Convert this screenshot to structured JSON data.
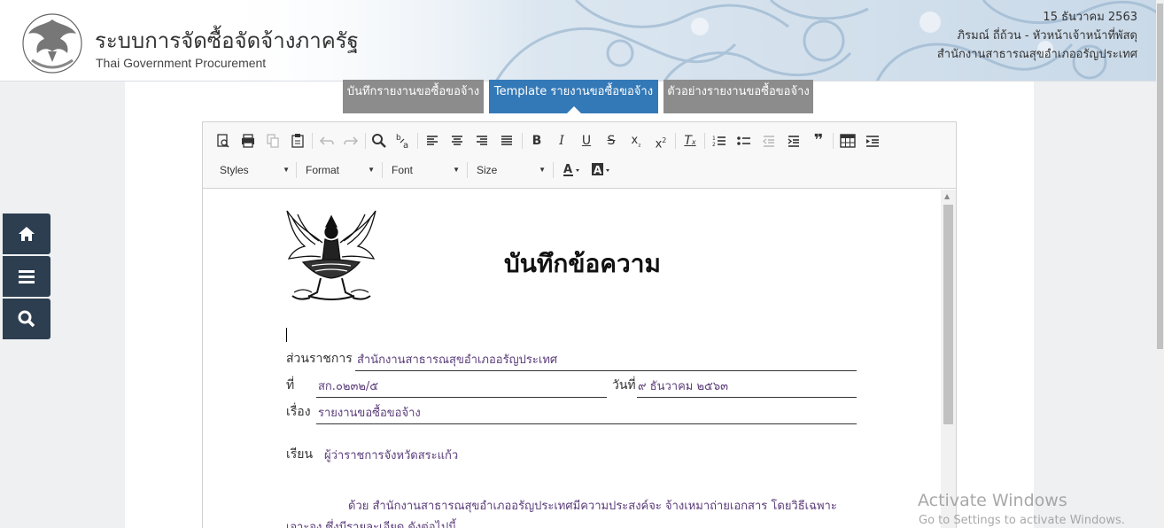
{
  "header": {
    "title": "ระบบการจัดซื้อจัดจ้างภาครัฐ",
    "subtitle": "Thai Government Procurement",
    "date": "15 ธันวาคม 2563",
    "user": "ภิรมณ์ ถี่ถ้วน - หัวหน้าเจ้าหน้าที่พัสดุ",
    "office": "สำนักงานสาธารณสุขอำเภออรัญประเทศ",
    "logo_icon": "thai-gov-procurement-logo"
  },
  "tabs": [
    {
      "label": "บันทึกรายงานขอซื้อขอจ้าง",
      "active": false
    },
    {
      "label": "Template รายงานขอซื้อขอจ้าง",
      "active": true
    },
    {
      "label": "ตัวอย่างรายงานขอซื้อขอจ้าง",
      "active": false
    }
  ],
  "toolbar": {
    "combos": {
      "styles": "Styles",
      "format": "Format",
      "font": "Font",
      "size": "Size"
    }
  },
  "document": {
    "emblem_icon": "garuda-emblem",
    "title": "บันทึกข้อความ",
    "agency_label": "ส่วนราชการ",
    "agency_value": "สำนักงานสาธารณสุขอำเภออรัญประเทศ",
    "ref_label": "ที่",
    "ref_value": "สก.๐๒๓๒/๕",
    "date_label": "วันที่",
    "date_value": "๙ ธันวาคม ๒๕๖๓",
    "subject_label": "เรื่อง",
    "subject_value": "รายงานขอซื้อขอจ้าง",
    "to_label": "เรียน",
    "to_value": "ผู้ว่าราชการจังหวัดสระแก้ว",
    "body_line1": "ด้วย สำนักงานสาธารณสุขอำเภออรัญประเทศมีความประสงค์จะ จ้างเหมาถ่ายเอกสาร โดยวิธีเฉพาะ",
    "body_line2": "เจาะจง ซึ่งมีรายละเอียด ดังต่อไปนี้"
  },
  "sidenav": [
    "home-icon",
    "menu-icon",
    "search-icon"
  ],
  "watermark": {
    "title": "Activate Windows",
    "sub": "Go to Settings to activate Windows."
  },
  "colors": {
    "tab_active": "#3479b7",
    "tab_inactive": "#8c8c8c",
    "nav_bg": "#2c3e50",
    "doc_value": "#5b3d7a"
  }
}
